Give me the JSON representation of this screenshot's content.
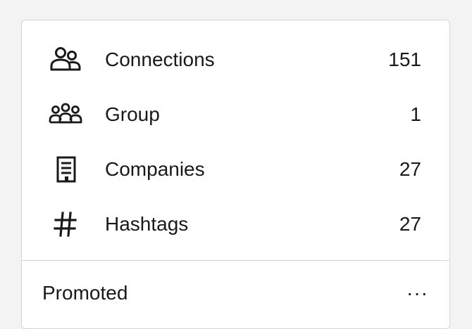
{
  "sidebar": {
    "items": [
      {
        "icon": "connections-icon",
        "label": "Connections",
        "count": "151"
      },
      {
        "icon": "group-icon",
        "label": "Group",
        "count": "1"
      },
      {
        "icon": "building-icon",
        "label": "Companies",
        "count": "27"
      },
      {
        "icon": "hashtag-icon",
        "label": "Hashtags",
        "count": "27"
      }
    ],
    "promoted_label": "Promoted",
    "more_label": "···"
  }
}
